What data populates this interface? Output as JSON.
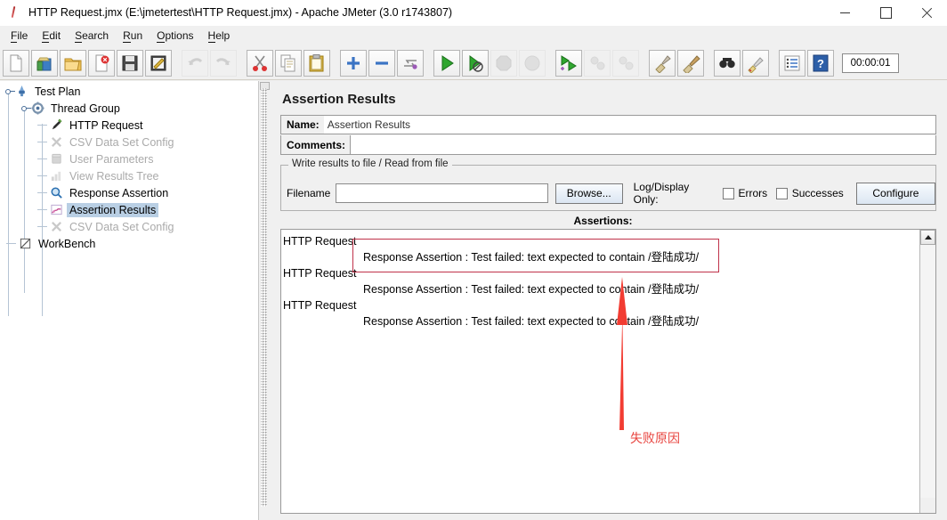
{
  "window": {
    "title": "HTTP Request.jmx (E:\\jmetertest\\HTTP Request.jmx) - Apache JMeter (3.0 r1743807)",
    "app_icon": "jmeter-feather-icon",
    "minimize_label": "–",
    "maximize_label": "□",
    "close_label": "✕"
  },
  "menubar": {
    "items": [
      {
        "label": "File",
        "mnemonic": "F",
        "rest": "ile"
      },
      {
        "label": "Edit",
        "mnemonic": "E",
        "rest": "dit"
      },
      {
        "label": "Search",
        "mnemonic": "S",
        "rest": "earch"
      },
      {
        "label": "Run",
        "mnemonic": "R",
        "rest": "un"
      },
      {
        "label": "Options",
        "mnemonic": "O",
        "rest": "ptions"
      },
      {
        "label": "Help",
        "mnemonic": "H",
        "rest": "elp"
      }
    ]
  },
  "toolbar": {
    "timer_value": "00:00:01",
    "buttons": [
      {
        "name": "new-icon",
        "tip": "New",
        "enabled": true
      },
      {
        "name": "templates-icon",
        "tip": "Templates",
        "enabled": true
      },
      {
        "name": "open-icon",
        "tip": "Open",
        "enabled": true
      },
      {
        "name": "close-icon",
        "tip": "Close",
        "enabled": true
      },
      {
        "name": "save-icon",
        "tip": "Save Test Plan",
        "enabled": true
      },
      {
        "name": "save-as-icon",
        "tip": "Save Test Plan as",
        "enabled": true
      },
      {
        "name": "undo-icon",
        "tip": "Undo",
        "enabled": false
      },
      {
        "name": "redo-icon",
        "tip": "Redo",
        "enabled": false
      },
      {
        "name": "cut-icon",
        "tip": "Cut",
        "enabled": true
      },
      {
        "name": "copy-icon",
        "tip": "Copy",
        "enabled": true
      },
      {
        "name": "paste-icon",
        "tip": "Paste",
        "enabled": true
      },
      {
        "name": "expand-all-icon",
        "tip": "Expand All",
        "enabled": true
      },
      {
        "name": "collapse-all-icon",
        "tip": "Collapse All",
        "enabled": true
      },
      {
        "name": "toggle-icon",
        "tip": "Toggle",
        "enabled": true
      },
      {
        "name": "start-icon",
        "tip": "Start",
        "enabled": true
      },
      {
        "name": "start-no-pauses-icon",
        "tip": "Start no pauses",
        "enabled": true
      },
      {
        "name": "stop-icon",
        "tip": "Stop",
        "enabled": false
      },
      {
        "name": "shutdown-icon",
        "tip": "Shutdown",
        "enabled": false
      },
      {
        "name": "remote-start-all-icon",
        "tip": "Remote Start All",
        "enabled": true
      },
      {
        "name": "remote-stop-all-icon",
        "tip": "Remote Stop All",
        "enabled": false
      },
      {
        "name": "remote-shutdown-icon",
        "tip": "Remote Shutdown All",
        "enabled": false
      },
      {
        "name": "clear-icon",
        "tip": "Clear",
        "enabled": true
      },
      {
        "name": "clear-all-icon",
        "tip": "Clear All",
        "enabled": true
      },
      {
        "name": "search-icon",
        "tip": "Search",
        "enabled": true
      },
      {
        "name": "search-reset-icon",
        "tip": "Reset Search",
        "enabled": true
      },
      {
        "name": "function-helper-icon",
        "tip": "Function Helper Dialog",
        "enabled": true
      },
      {
        "name": "help-icon",
        "tip": "Help",
        "enabled": true
      }
    ]
  },
  "tree": {
    "items": [
      {
        "label": "Test Plan",
        "icon": "test-plan-icon",
        "depth": 0,
        "enabled": true,
        "selected": false,
        "expander": true
      },
      {
        "label": "Thread Group",
        "icon": "thread-group-icon",
        "depth": 1,
        "enabled": true,
        "selected": false,
        "expander": true
      },
      {
        "label": "HTTP Request",
        "icon": "http-request-icon",
        "depth": 2,
        "enabled": true,
        "selected": false,
        "expander": false
      },
      {
        "label": "CSV Data Set Config",
        "icon": "csv-data-set-icon",
        "depth": 2,
        "enabled": false,
        "selected": false,
        "expander": false
      },
      {
        "label": "User Parameters",
        "icon": "user-parameters-icon",
        "depth": 2,
        "enabled": false,
        "selected": false,
        "expander": false
      },
      {
        "label": "View Results Tree",
        "icon": "view-results-tree-icon",
        "depth": 2,
        "enabled": false,
        "selected": false,
        "expander": false
      },
      {
        "label": "Response Assertion",
        "icon": "response-assertion-icon",
        "depth": 2,
        "enabled": true,
        "selected": false,
        "expander": false
      },
      {
        "label": "Assertion Results",
        "icon": "assertion-results-icon",
        "depth": 2,
        "enabled": true,
        "selected": true,
        "expander": false
      },
      {
        "label": "CSV Data Set Config",
        "icon": "csv-data-set-icon",
        "depth": 2,
        "enabled": false,
        "selected": false,
        "expander": false
      },
      {
        "label": "WorkBench",
        "icon": "workbench-icon",
        "depth": 0,
        "enabled": true,
        "selected": false,
        "expander": false
      }
    ]
  },
  "main": {
    "panel_title": "Assertion Results",
    "name_label": "Name:",
    "name_value": "Assertion Results",
    "comments_label": "Comments:",
    "comments_value": "",
    "group_legend": "Write results to file / Read from file",
    "filename_label": "Filename",
    "filename_value": "",
    "filename_placeholder": "",
    "browse_label": "Browse...",
    "log_display_label": "Log/Display Only:",
    "errors_label": "Errors",
    "errors_checked": false,
    "successes_label": "Successes",
    "successes_checked": false,
    "configure_label": "Configure",
    "assertions_label": "Assertions:",
    "rows": [
      {
        "text": "HTTP Request",
        "child": false
      },
      {
        "text": "Response Assertion : Test failed: text expected to contain /登陆成功/",
        "child": true
      },
      {
        "text": "HTTP Request",
        "child": false
      },
      {
        "text": "Response Assertion : Test failed: text expected to contain /登陆成功/",
        "child": true
      },
      {
        "text": "HTTP Request",
        "child": false
      },
      {
        "text": "Response Assertion : Test failed: text expected to contain /登陆成功/",
        "child": true
      }
    ]
  },
  "annotation": {
    "color": "#e8443f",
    "box_color": "#c0324a",
    "caption": "失败原因",
    "arrow_name": "red-up-arrow",
    "box_name": "red-highlight-box"
  }
}
